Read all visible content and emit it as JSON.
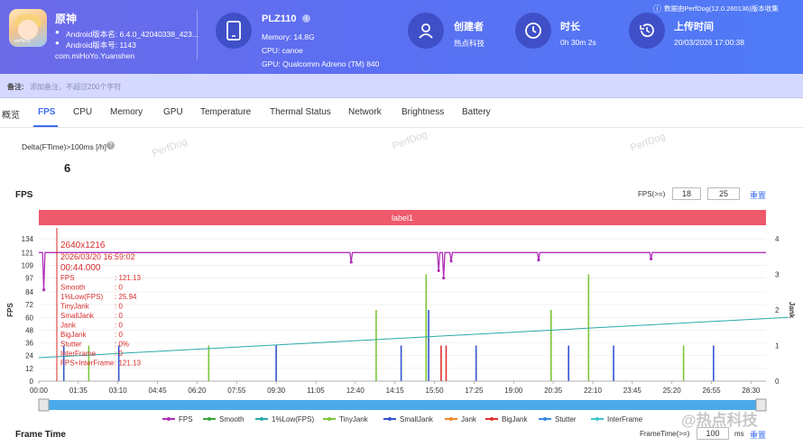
{
  "app": {
    "name": "原神",
    "android_version": "Android版本名: 6.4.0_42040338_423...",
    "android_code": "Android版本号: 1143",
    "package": "com.miHoYo.Yuanshen",
    "icon_text": "miHoYo"
  },
  "device": {
    "name": "PLZ110",
    "memory": "Memory: 14.8G",
    "cpu": "CPU: canoe",
    "gpu": "GPU: Qualcomm Adreno (TM) 840"
  },
  "creator": {
    "label": "创建者",
    "value": "热点科技"
  },
  "duration": {
    "label": "时长",
    "value": "0h 30m 2s"
  },
  "upload": {
    "label": "上传时间",
    "value": "20/03/2026 17:00:38"
  },
  "data_source": "数据由PerfDog(12.0.260136)版本收集",
  "note": {
    "label": "备注:",
    "placeholder": "添加备注，不超过200个字符"
  },
  "tabs": [
    "概览",
    "FPS",
    "CPU",
    "Memory",
    "GPU",
    "Temperature",
    "Thermal Status",
    "Network",
    "Brightness",
    "Battery"
  ],
  "active_tab": "FPS",
  "delta": {
    "label": "Delta(FTime)>100ms [/h]",
    "value": "6"
  },
  "watermark": "PerfDog",
  "fps_section": {
    "title": "FPS",
    "threshold_label": "FPS(>=)",
    "threshold_1": "18",
    "threshold_2": "25",
    "reset_label": "重置"
  },
  "frametime_section": {
    "title": "Frame Time",
    "threshold_label": "FrameTime(>=)",
    "threshold_value": "100",
    "unit": "ms",
    "reset_label": "重置"
  },
  "tooltip": {
    "resolution": "2640x1216",
    "date": "2026/03/20 16:59:02",
    "time": "00:44.000",
    "rows": [
      {
        "k": "FPS",
        "v": ": 121.13"
      },
      {
        "k": "Smooth",
        "v": ": 0"
      },
      {
        "k": "1%Low(FPS)",
        "v": ": 25.94"
      },
      {
        "k": "TinyJank",
        "v": ": 0"
      },
      {
        "k": "SmallJank",
        "v": ": 0"
      },
      {
        "k": "Jank",
        "v": ": 0"
      },
      {
        "k": "BigJank",
        "v": ": 0"
      },
      {
        "k": "Stutter",
        "v": ": 0%"
      },
      {
        "k": "InterFrame",
        "v": ": 0"
      },
      {
        "k": "FPS+InterFrame",
        "v": ": 121.13"
      }
    ]
  },
  "footer_watermark": "@热点科技",
  "colors": {
    "header": "#5b6ff2",
    "fps": "#b12fb8",
    "smooth": "#3aa63a",
    "low1": "#2aa8a8",
    "tinyjank": "#7cc63a",
    "smalljank": "#3353d0",
    "jank": "#f08a2a",
    "bigjank": "#e03030",
    "stutter": "#3b8be0",
    "interframe": "#3fc6d0",
    "label_band": "#ee5a6a"
  },
  "chart_data": {
    "type": "line",
    "label_band": "label1",
    "xlabel": "",
    "ylabel": "FPS",
    "y2label": "Jank",
    "ylim": [
      0,
      134
    ],
    "y2lim": [
      0,
      4
    ],
    "yticks": [
      0,
      12,
      24,
      36,
      48,
      60,
      72,
      84,
      97,
      109,
      121,
      134
    ],
    "y2ticks": [
      0,
      1,
      2,
      3,
      4
    ],
    "x_ticks": [
      "00:00",
      "01:35",
      "03:10",
      "04:45",
      "06:20",
      "07:55",
      "09:30",
      "11:05",
      "12:40",
      "14:15",
      "15:50",
      "17:25",
      "19:00",
      "20:35",
      "22:10",
      "23:45",
      "25:20",
      "26:55",
      "28:30"
    ],
    "legend": [
      "FPS",
      "Smooth",
      "1%Low(FPS)",
      "TinyJank",
      "SmallJank",
      "Jank",
      "BigJank",
      "Stutter",
      "InterFrame"
    ],
    "legend_position": "bottom",
    "fps_baseline": 121,
    "fps_dips": [
      {
        "t": 0.2,
        "v": 86
      },
      {
        "t": 12.5,
        "v": 112
      },
      {
        "t": 16.0,
        "v": 104
      },
      {
        "t": 16.2,
        "v": 97
      },
      {
        "t": 16.5,
        "v": 113
      },
      {
        "t": 20.0,
        "v": 114
      },
      {
        "t": 24.5,
        "v": 115
      }
    ],
    "low1_series": {
      "t": [
        0,
        30
      ],
      "v": [
        22,
        60
      ]
    },
    "jank_spikes": [
      {
        "t": 1.0,
        "v": 1,
        "s": "smalljank"
      },
      {
        "t": 2.0,
        "v": 1,
        "s": "tinyjank"
      },
      {
        "t": 3.2,
        "v": 1,
        "s": "smalljank"
      },
      {
        "t": 6.8,
        "v": 1,
        "s": "tinyjank"
      },
      {
        "t": 9.5,
        "v": 1,
        "s": "smalljank"
      },
      {
        "t": 13.5,
        "v": 2,
        "s": "tinyjank"
      },
      {
        "t": 14.5,
        "v": 1,
        "s": "smalljank"
      },
      {
        "t": 15.5,
        "v": 3,
        "s": "tinyjank"
      },
      {
        "t": 15.6,
        "v": 2,
        "s": "smalljank"
      },
      {
        "t": 16.1,
        "v": 1,
        "s": "bigjank"
      },
      {
        "t": 16.3,
        "v": 1,
        "s": "bigjank"
      },
      {
        "t": 17.5,
        "v": 1,
        "s": "smalljank"
      },
      {
        "t": 20.5,
        "v": 2,
        "s": "tinyjank"
      },
      {
        "t": 21.2,
        "v": 1,
        "s": "smalljank"
      },
      {
        "t": 22.0,
        "v": 3,
        "s": "tinyjank"
      },
      {
        "t": 23.0,
        "v": 1,
        "s": "smalljank"
      },
      {
        "t": 25.8,
        "v": 1,
        "s": "tinyjank"
      },
      {
        "t": 27.0,
        "v": 1,
        "s": "smalljank"
      }
    ]
  }
}
